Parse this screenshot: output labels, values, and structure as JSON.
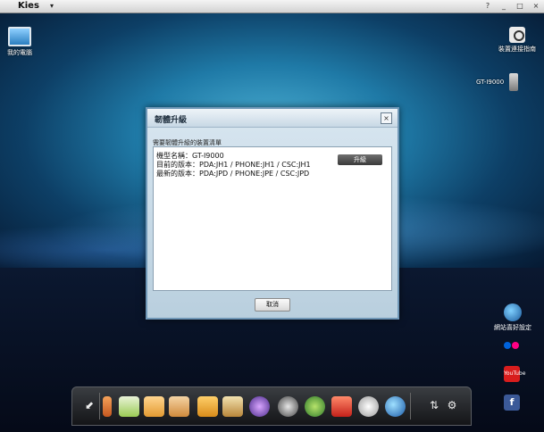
{
  "window": {
    "app_title": "Kies"
  },
  "desktop": {
    "my_computer_label": "我的電腦",
    "connection_guide_label": "裝置連接指南",
    "device_label": "GT-I9000"
  },
  "dialog": {
    "title": "韌體升級",
    "section_label": "需要韌體升級的裝置清單",
    "rows": [
      "機型名稱：GT-I9000",
      "目前的版本：PDA:JH1 / PHONE:JH1 / CSC:JH1",
      "最新的版本：PDA:JPD / PHONE:JPE / CSC:JPD"
    ],
    "upgrade_button": "升級",
    "cancel_button": "取消"
  },
  "side_panel": {
    "web_settings_label": "網站喜好設定",
    "youtube_text": "YouTube",
    "facebook_text": "f"
  },
  "colors": {
    "desktop_accent": "#1f7aa7",
    "dialog_border": "#6f97b7",
    "upgrade_button_bg": "#3a3a3a"
  }
}
